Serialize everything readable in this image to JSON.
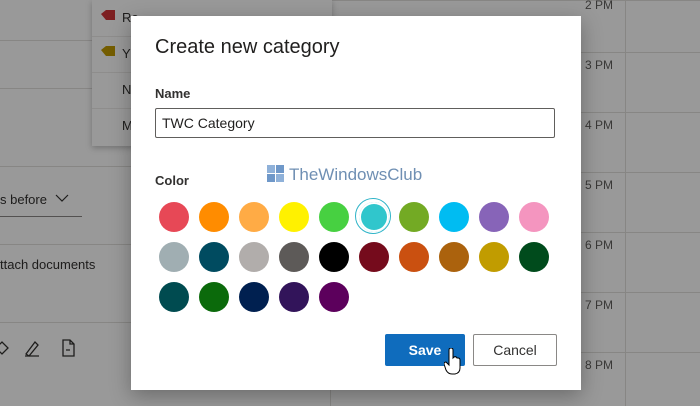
{
  "background": {
    "dropdown_items": [
      {
        "label": "Red",
        "visible_text": "Re",
        "tag_color": "#d13438"
      },
      {
        "label": "Yellow",
        "visible_text": "Y",
        "tag_color": "#c19c00"
      },
      {
        "label": "N",
        "visible_text": "N"
      },
      {
        "label": "M",
        "visible_text": "M"
      }
    ],
    "reminder_text": "s before",
    "attach_text": "ttach documents",
    "times": [
      "2 PM",
      "3 PM",
      "4 PM",
      "5 PM",
      "6 PM",
      "7 PM",
      "8 PM"
    ]
  },
  "dialog": {
    "title": "Create new category",
    "name_label": "Name",
    "name_value": "TWC Category",
    "color_label": "Color",
    "colors": [
      "#e74856",
      "#ff8c00",
      "#ffab45",
      "#fff100",
      "#47d041",
      "#30c6cc",
      "#73aa24",
      "#00bcf2",
      "#8764b8",
      "#f495bf",
      "#a0aeb2",
      "#004b60",
      "#b1adab",
      "#5d5a58",
      "#000000",
      "#750b1c",
      "#ca5010",
      "#ab620d",
      "#c19c00",
      "#004b1c",
      "#004b50",
      "#0b6a0b",
      "#002050",
      "#32145a",
      "#5c005c"
    ],
    "selected_color_index": 5,
    "save_label": "Save",
    "cancel_label": "Cancel"
  },
  "watermark": {
    "text": "TheWindowsClub"
  },
  "colors": {
    "primary": "#0f6cbd",
    "overlay": "rgba(0,0,0,0.4)"
  }
}
